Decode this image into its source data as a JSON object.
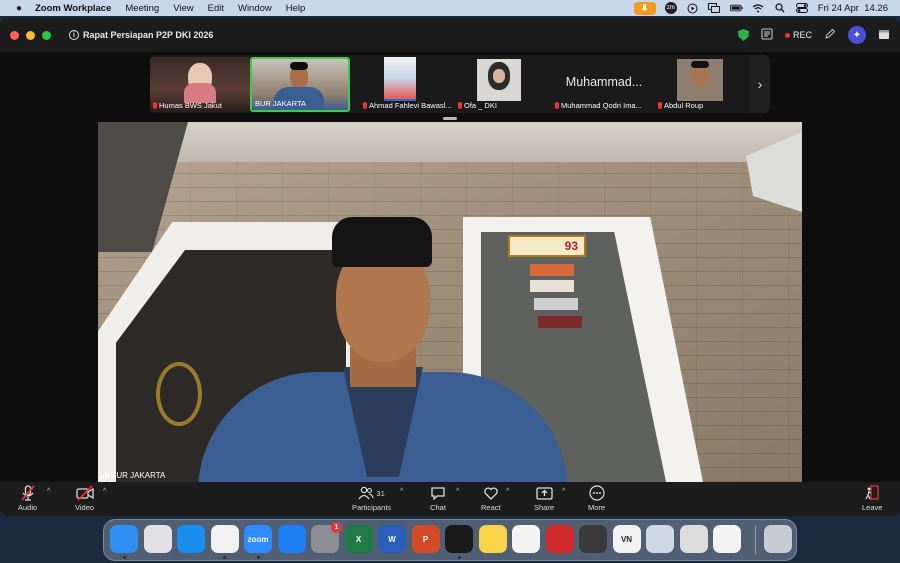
{
  "menubar": {
    "app_name": "Zoom Workplace",
    "menus": [
      "Meeting",
      "View",
      "Edit",
      "Window",
      "Help"
    ],
    "clock": "Fri 24 Apr  14.26"
  },
  "meeting": {
    "title": "Rapat Persiapan P2P DKI 2026",
    "rec_label": "REC"
  },
  "participants_strip": [
    {
      "name": "Humas BWS Jakut",
      "muted": true
    },
    {
      "name": "BUR JAKARTA",
      "muted": false,
      "active": true
    },
    {
      "name": "Ahmad Fahlevi Bawasl...",
      "muted": true
    },
    {
      "name": "Ofa _ DKI",
      "muted": true
    },
    {
      "name": "Muhammad Qodri Ima...",
      "muted": true,
      "big_name": "Muhammad..."
    },
    {
      "name": "Abdul Roup",
      "muted": true
    }
  ],
  "main_video": {
    "speaker": "BUR JAKARTA",
    "plaque_text": "93"
  },
  "toolbar": {
    "audio": "Audio",
    "video": "Video",
    "participants": "Participants",
    "participants_count": "31",
    "chat": "Chat",
    "react": "React",
    "share": "Share",
    "more": "More",
    "leave": "Leave"
  },
  "dock": {
    "apps": [
      {
        "name": "Finder",
        "color": "#2f8ff2",
        "label": "",
        "running": true
      },
      {
        "name": "Launchpad",
        "color": "#e2e2e6",
        "label": "",
        "running": false
      },
      {
        "name": "Safari",
        "color": "#1a8ff0",
        "label": "",
        "running": false
      },
      {
        "name": "Chrome",
        "color": "#f1f1f1",
        "label": "",
        "running": true
      },
      {
        "name": "Zoom",
        "color": "#2d8cff",
        "label": "zoom",
        "running": true
      },
      {
        "name": "App Store",
        "color": "#1c7ff3",
        "label": "",
        "running": false
      },
      {
        "name": "System Settings",
        "color": "#8d8d93",
        "label": "",
        "running": false,
        "badge": "1"
      },
      {
        "name": "Excel",
        "color": "#1f7a45",
        "label": "X",
        "running": false
      },
      {
        "name": "Word",
        "color": "#2b5eb8",
        "label": "W",
        "running": false
      },
      {
        "name": "PowerPoint",
        "color": "#d24a26",
        "label": "P",
        "running": false
      },
      {
        "name": "Spotify",
        "color": "#1a1a1a",
        "label": "",
        "running": true
      },
      {
        "name": "Notes",
        "color": "#f7d548",
        "label": "",
        "running": false
      },
      {
        "name": "Freeform",
        "color": "#f4f4f4",
        "label": "",
        "running": false
      },
      {
        "name": "PDF Reader",
        "color": "#d22b2b",
        "label": "",
        "running": false
      },
      {
        "name": "Calculator",
        "color": "#3a3a3a",
        "label": "",
        "running": false
      },
      {
        "name": "VN",
        "color": "#f2f2f2",
        "label": "VN",
        "running": false
      },
      {
        "name": "Preview",
        "color": "#cfd9e6",
        "label": "",
        "running": false
      },
      {
        "name": "iPhone Mirroring",
        "color": "#dcdcdc",
        "label": "",
        "running": false
      },
      {
        "name": "CapCut",
        "color": "#f4f4f4",
        "label": "",
        "running": false
      },
      {
        "name": "Trash",
        "color": "#c7ccd3",
        "label": "",
        "running": false
      }
    ]
  },
  "colors": {
    "accent": "#3fca4a",
    "mute_red": "#e8343a",
    "ai_purple": "#4b4ed6",
    "zoom_blue": "#2d8cff"
  }
}
